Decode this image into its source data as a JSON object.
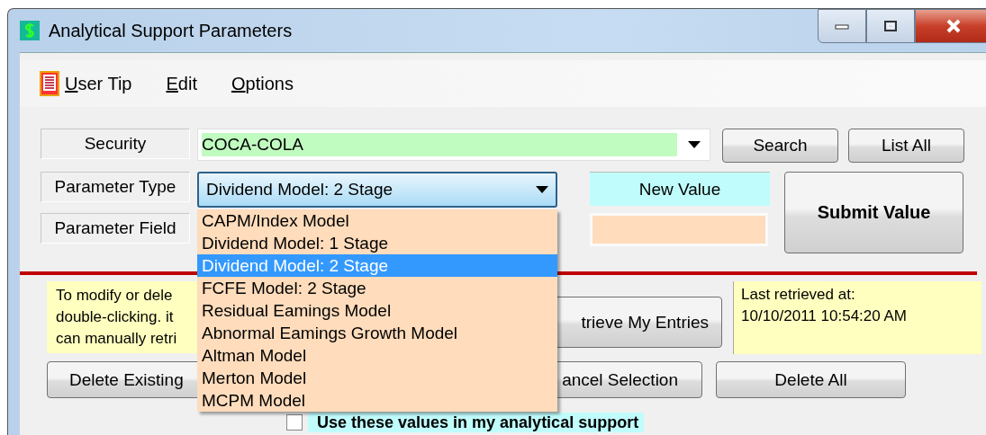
{
  "window": {
    "title": "Analytical Support Parameters"
  },
  "menu": [
    {
      "label": "User Tip",
      "kind": "icon"
    },
    {
      "label": "Edit",
      "kind": "plain"
    },
    {
      "label": "Options",
      "kind": "plain"
    }
  ],
  "security": {
    "label": "Security",
    "value": "COCA-COLA"
  },
  "search_button": "Search",
  "list_all_button": "List All",
  "parameter_type": {
    "label": "Parameter Type",
    "value": "Dividend Model: 2 Stage",
    "expanded": true,
    "options": [
      {
        "label": "CAPM/Index Model",
        "selected": false
      },
      {
        "label": "Dividend Model: 1 Stage",
        "selected": false
      },
      {
        "label": "Dividend Model: 2 Stage",
        "selected": true
      },
      {
        "label": "FCFE Model: 2 Stage",
        "selected": false
      },
      {
        "label": "Residual Eamings Model",
        "selected": false
      },
      {
        "label": "Abnormal Eamings Growth Model",
        "selected": false
      },
      {
        "label": "Altman Model",
        "selected": false
      },
      {
        "label": "Merton Model",
        "selected": false
      },
      {
        "label": "MCPM Model",
        "selected": false
      }
    ]
  },
  "parameter_field": {
    "label": "Parameter Field"
  },
  "new_value": {
    "label": "New Value"
  },
  "submit_button": "Submit Value",
  "info_text": [
    "To modify or dele",
    "double-clicking. it",
    "can manually retri"
  ],
  "retrieve_button": "trieve My Entries",
  "last_retrieved": [
    "Last retrieved at:",
    "10/10/2011 10:54:20 AM"
  ],
  "delete_existing_button": "Delete Existing",
  "cancel_selection_button": "ancel Selection",
  "delete_all_button": "Delete All",
  "use_values": {
    "label": "Use these values in my analytical support",
    "checked": false
  }
}
